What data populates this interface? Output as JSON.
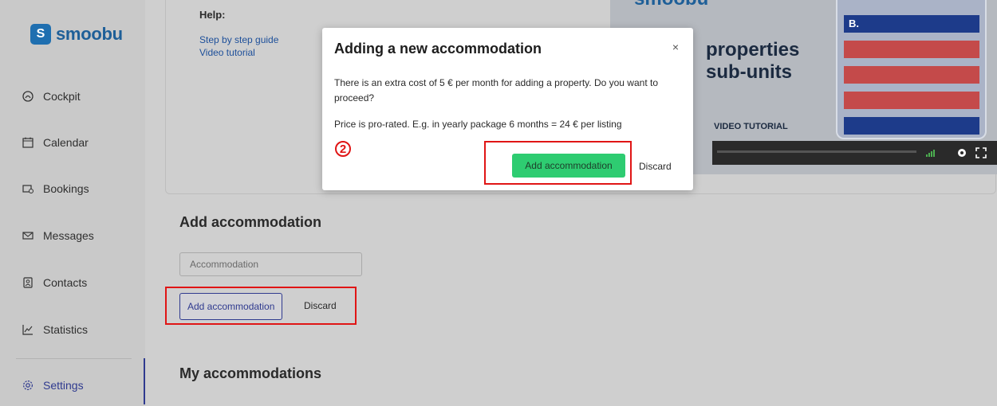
{
  "brand": {
    "logo_mark": "S",
    "name": "smoobu",
    "color": "#1f6fb0"
  },
  "sidebar": {
    "items": [
      {
        "label": "Cockpit",
        "icon": "cockpit-icon"
      },
      {
        "label": "Calendar",
        "icon": "calendar-icon"
      },
      {
        "label": "Bookings",
        "icon": "bookings-icon"
      },
      {
        "label": "Messages",
        "icon": "envelope-icon"
      },
      {
        "label": "Contacts",
        "icon": "contacts-icon"
      },
      {
        "label": "Statistics",
        "icon": "chart-icon"
      },
      {
        "label": "Settings",
        "icon": "gear-icon",
        "active": true
      }
    ]
  },
  "help": {
    "title": "Help:",
    "links": [
      "Step by step guide",
      "Video tutorial"
    ]
  },
  "video": {
    "brand": "smoobu",
    "headline_1": "properties",
    "headline_2": "sub-units",
    "label": "VIDEO TUTORIAL",
    "strips": [
      "B.",
      "",
      "",
      "",
      ""
    ]
  },
  "add_section": {
    "title": "Add accommodation",
    "input_placeholder": "Accommodation",
    "add_button": "Add accommodation",
    "discard": "Discard"
  },
  "my_section": {
    "title": "My accommodations"
  },
  "modal": {
    "title": "Adding a new accommodation",
    "close": "×",
    "message": "There is an extra cost of 5 € per month for adding a property. Do you want to proceed?",
    "price_note": "Price is pro-rated. E.g. in yearly package 6 months = 24 € per listing",
    "step_marker": "2",
    "confirm_button": "Add accommodation",
    "discard": "Discard"
  },
  "colors": {
    "accent": "#2f3a8f",
    "confirm": "#2ecc71",
    "highlight": "#e01515"
  }
}
